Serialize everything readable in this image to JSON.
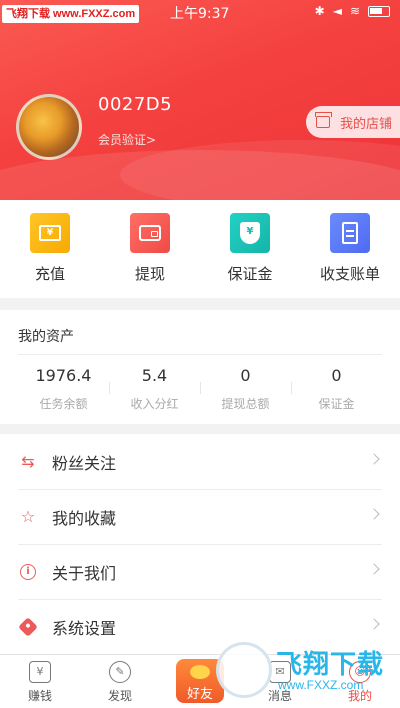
{
  "watermark_top": "飞翔下载 www.FXXZ.com",
  "status_bar": {
    "time": "上午9:37",
    "bluetooth": "✱",
    "mute": "◄",
    "wifi": "≋"
  },
  "profile": {
    "username": "0027D5",
    "member_verify": "会员验证>",
    "shop_button": "我的店铺"
  },
  "actions": [
    {
      "label": "充值",
      "icon": "recharge-card-icon",
      "icon_text": "¥",
      "color": "#f7a900"
    },
    {
      "label": "提现",
      "icon": "wallet-icon",
      "color": "#ef4b45"
    },
    {
      "label": "保证金",
      "icon": "shield-yen-icon",
      "icon_text": "¥",
      "color": "#14b5a8"
    },
    {
      "label": "收支账单",
      "icon": "bill-icon",
      "color": "#4e6bf0"
    }
  ],
  "assets": {
    "title": "我的资产",
    "items": [
      {
        "value": "1976.4",
        "caption": "任务余额"
      },
      {
        "value": "5.4",
        "caption": "收入分红"
      },
      {
        "value": "0",
        "caption": "提现总额"
      },
      {
        "value": "0",
        "caption": "保证金"
      }
    ]
  },
  "menu": [
    {
      "label": "粉丝关注",
      "icon": "swap-arrows-icon",
      "glyph": "⇆"
    },
    {
      "label": "我的收藏",
      "icon": "star-outline-icon",
      "glyph": "☆"
    },
    {
      "label": "关于我们",
      "icon": "info-circle-icon",
      "glyph": "i"
    },
    {
      "label": "系统设置",
      "icon": "settings-hex-icon"
    }
  ],
  "tabbar": [
    {
      "label": "赚钱",
      "glyph": "¥"
    },
    {
      "label": "发现",
      "glyph": "✎"
    },
    {
      "label": "好友"
    },
    {
      "label": "消息",
      "glyph": "✉"
    },
    {
      "label": "我的",
      "glyph": "☺"
    }
  ],
  "watermark_bottom": {
    "text": "飞翔下载",
    "url": "www.FXXZ.com"
  },
  "colors": {
    "header": "#f4413f",
    "accent": "#ec4a45",
    "watermark": "#29b6e8"
  }
}
